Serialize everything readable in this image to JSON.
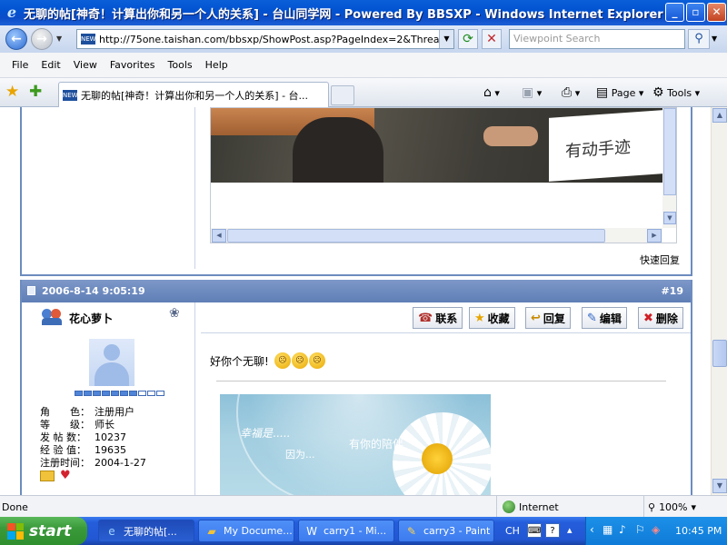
{
  "window": {
    "title": "无聊的帖[神奇！计算出你和另一个人的关系] - 台山同学网 - Powered By BBSXP - Windows Internet Explorer",
    "min": "_",
    "max": "▫",
    "close": "✕"
  },
  "address": {
    "url": "http://75one.taishan.com/bbsxp/ShowPost.asp?PageIndex=2&ThreadID=457",
    "search_placeholder": "Viewpoint Search"
  },
  "menu": [
    "File",
    "Edit",
    "View",
    "Favorites",
    "Tools",
    "Help"
  ],
  "tab": {
    "label": "无聊的帖[神奇！计算出你和另一个人的关系] - 台...",
    "site_icon_text": "NEW"
  },
  "commands": {
    "page": "Page",
    "tools": "Tools"
  },
  "prev_post": {
    "image_caption": "有动手迹",
    "quick_reply": "快速回复"
  },
  "post": {
    "date": "2006-8-14 9:05:19",
    "floor": "#19",
    "username": "花心萝卜",
    "rank_level": 0.7,
    "info": [
      {
        "k": "角　　色：",
        "v": "注册用户"
      },
      {
        "k": "等　　级：",
        "v": "师长"
      },
      {
        "k": "发 帖 数：",
        "v": "10237"
      },
      {
        "k": "经 验 值：",
        "v": "19635"
      },
      {
        "k": "注册时间：",
        "v": "2004-1-27"
      }
    ],
    "actions": [
      "联系",
      "收藏",
      "回复",
      "编辑",
      "删除"
    ],
    "text": "好你个无聊!",
    "image_texts": [
      "幸福是.....",
      "因为...",
      "有你的陪伴"
    ]
  },
  "status": {
    "text": "Done",
    "zone": "Internet",
    "zoom": "100%"
  },
  "taskbar": {
    "start": "start",
    "tasks": [
      "无聊的帖[...",
      "My Docume...",
      "carry1 - Mi...",
      "carry3 - Paint"
    ],
    "lang": "CH",
    "time": "10:45 PM"
  }
}
